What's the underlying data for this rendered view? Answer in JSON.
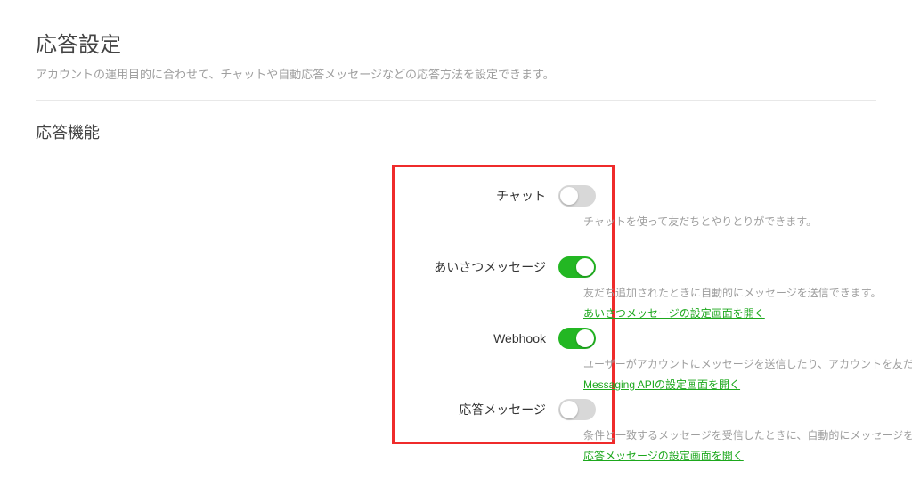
{
  "page": {
    "title": "応答設定",
    "subtitle": "アカウントの運用目的に合わせて、チャットや自動応答メッセージなどの応答方法を設定できます。"
  },
  "section": {
    "title": "応答機能"
  },
  "rows": {
    "chat": {
      "label": "チャット",
      "enabled": false,
      "description": "チャットを使って友だちとやりとりができます。"
    },
    "greeting": {
      "label": "あいさつメッセージ",
      "enabled": true,
      "description": "友だち追加されたときに自動的にメッセージを送信できます。",
      "link": "あいさつメッセージの設定画面を開く"
    },
    "webhook": {
      "label": "Webhook",
      "enabled": true,
      "description": "ユーザーがアカウントにメッセージを送信したり、アカウントを友だ",
      "link": "Messaging APIの設定画面を開く"
    },
    "autoreply": {
      "label": "応答メッセージ",
      "enabled": false,
      "description": "条件と一致するメッセージを受信したときに、自動的にメッセージを",
      "link": "応答メッセージの設定画面を開く"
    }
  }
}
